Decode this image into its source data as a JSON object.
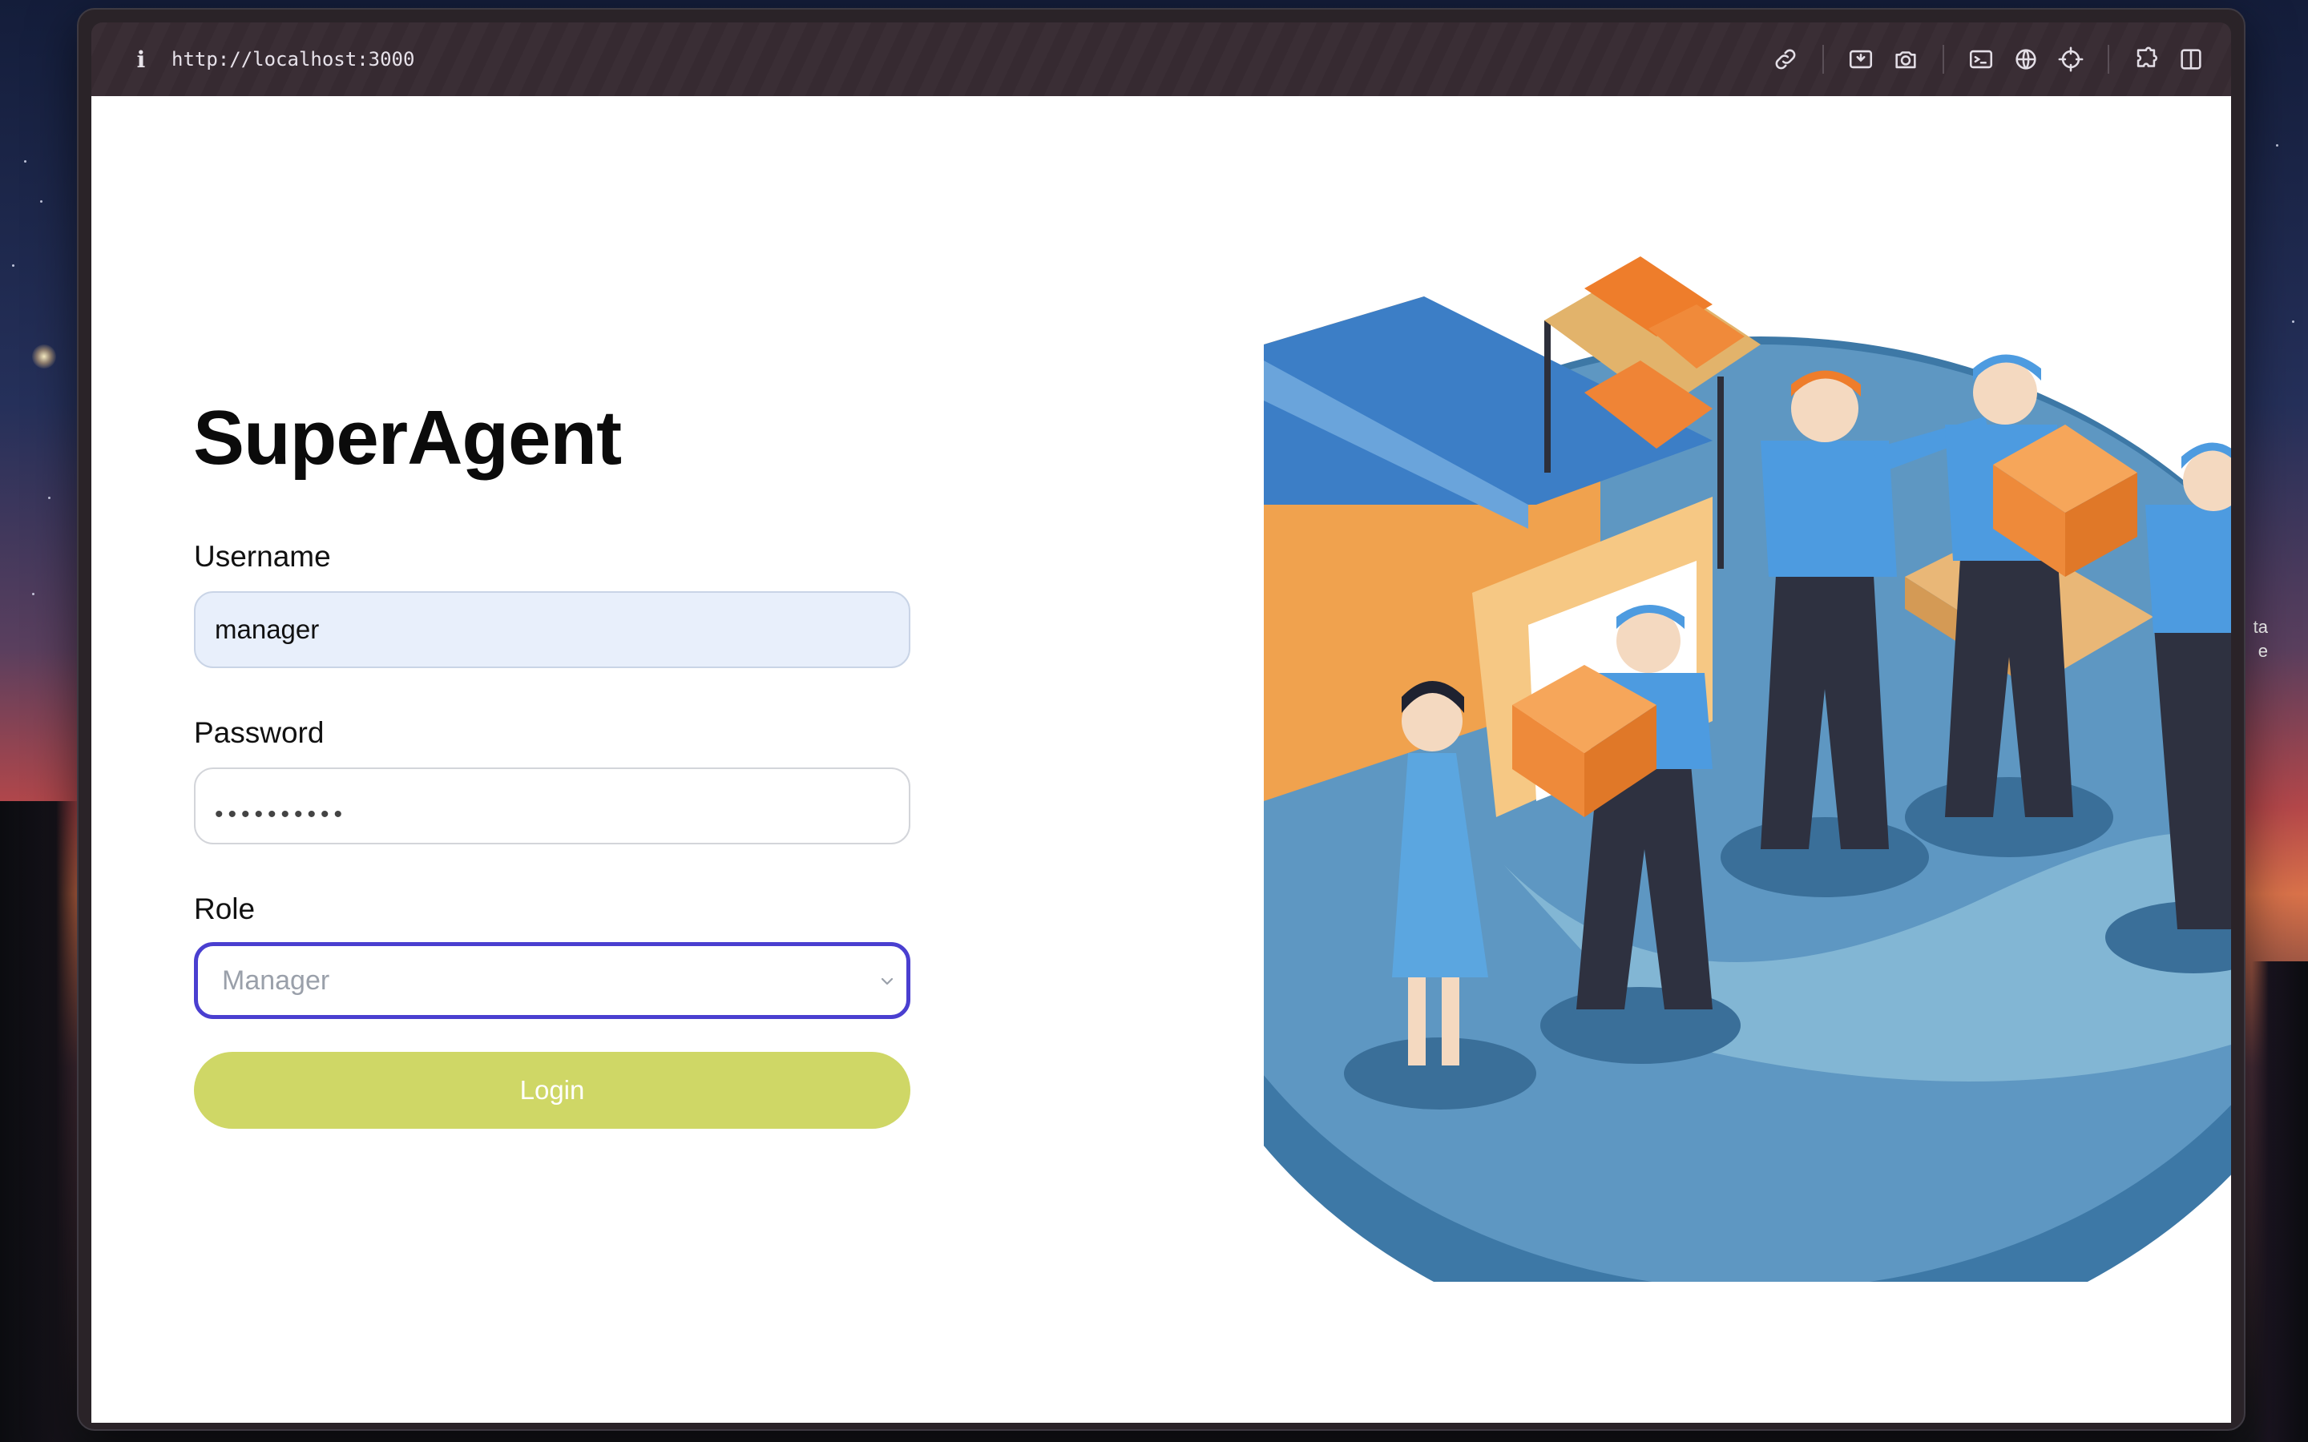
{
  "browser": {
    "url": "http://localhost:3000",
    "info_glyph": "i"
  },
  "login": {
    "title": "SuperAgent",
    "username_label": "Username",
    "username_value": "manager",
    "password_label": "Password",
    "password_masked": "••••••••••",
    "role_label": "Role",
    "role_selected": "Manager",
    "login_button": "Login"
  },
  "desktop": {
    "side_text_1": "ta",
    "side_text_2": "e"
  },
  "colors": {
    "accent_focus": "#4a3fd0",
    "login_button": "#cfd766",
    "input_filled": "#e8effb"
  }
}
